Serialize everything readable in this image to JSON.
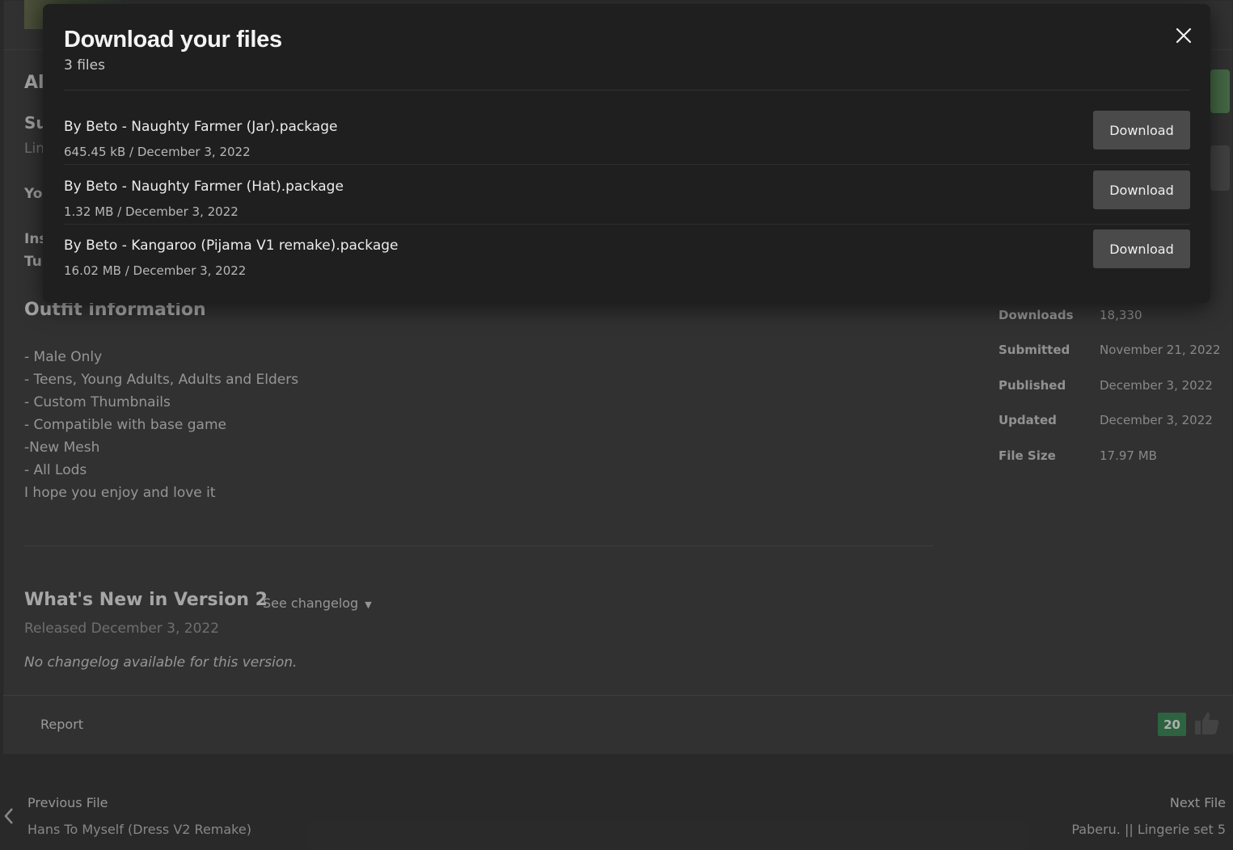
{
  "modal": {
    "title": "Download your files",
    "subtitle": "3 files",
    "files": [
      {
        "name": "By Beto - Naughty Farmer (Jar).package",
        "meta": "645.45 kB / December 3, 2022",
        "button": "Download"
      },
      {
        "name": "By Beto - Naughty Farmer (Hat).package",
        "meta": "1.32 MB / December 3, 2022",
        "button": "Download"
      },
      {
        "name": "By Beto - Kangaroo (Pijama V1 remake).package",
        "meta": "16.02 MB / December 3, 2022",
        "button": "Download"
      }
    ]
  },
  "background": {
    "partial": {
      "a": "Al",
      "b": "Su",
      "c": "Lin",
      "d": "Yo",
      "e": "Ins",
      "f": "Tu"
    },
    "outfit_heading": "Outfit information",
    "outfit_lines": [
      "- Male Only",
      "- Teens, Young Adults, Adults and Elders",
      "- Custom Thumbnails",
      "- Compatible with base game",
      "-New Mesh",
      "- All Lods",
      "I hope you enjoy and love it"
    ],
    "whats_new_heading": "What's New in Version 2",
    "see_changelog": "See changelog",
    "released": "Released December 3, 2022",
    "no_changelog": "No changelog available for this version.",
    "report": "Report",
    "likes": "20",
    "stats": [
      {
        "label": "Downloads",
        "value": "18,330"
      },
      {
        "label": "Submitted",
        "value": "November 21, 2022"
      },
      {
        "label": "Published",
        "value": "December 3, 2022"
      },
      {
        "label": "Updated",
        "value": "December 3, 2022"
      },
      {
        "label": "File Size",
        "value": "17.97 MB"
      }
    ],
    "prev_label": "Previous File",
    "prev_title": "Hans To Myself (Dress V2 Remake)",
    "next_label": "Next File",
    "next_title": "Paberu. || Lingerie set 5"
  }
}
